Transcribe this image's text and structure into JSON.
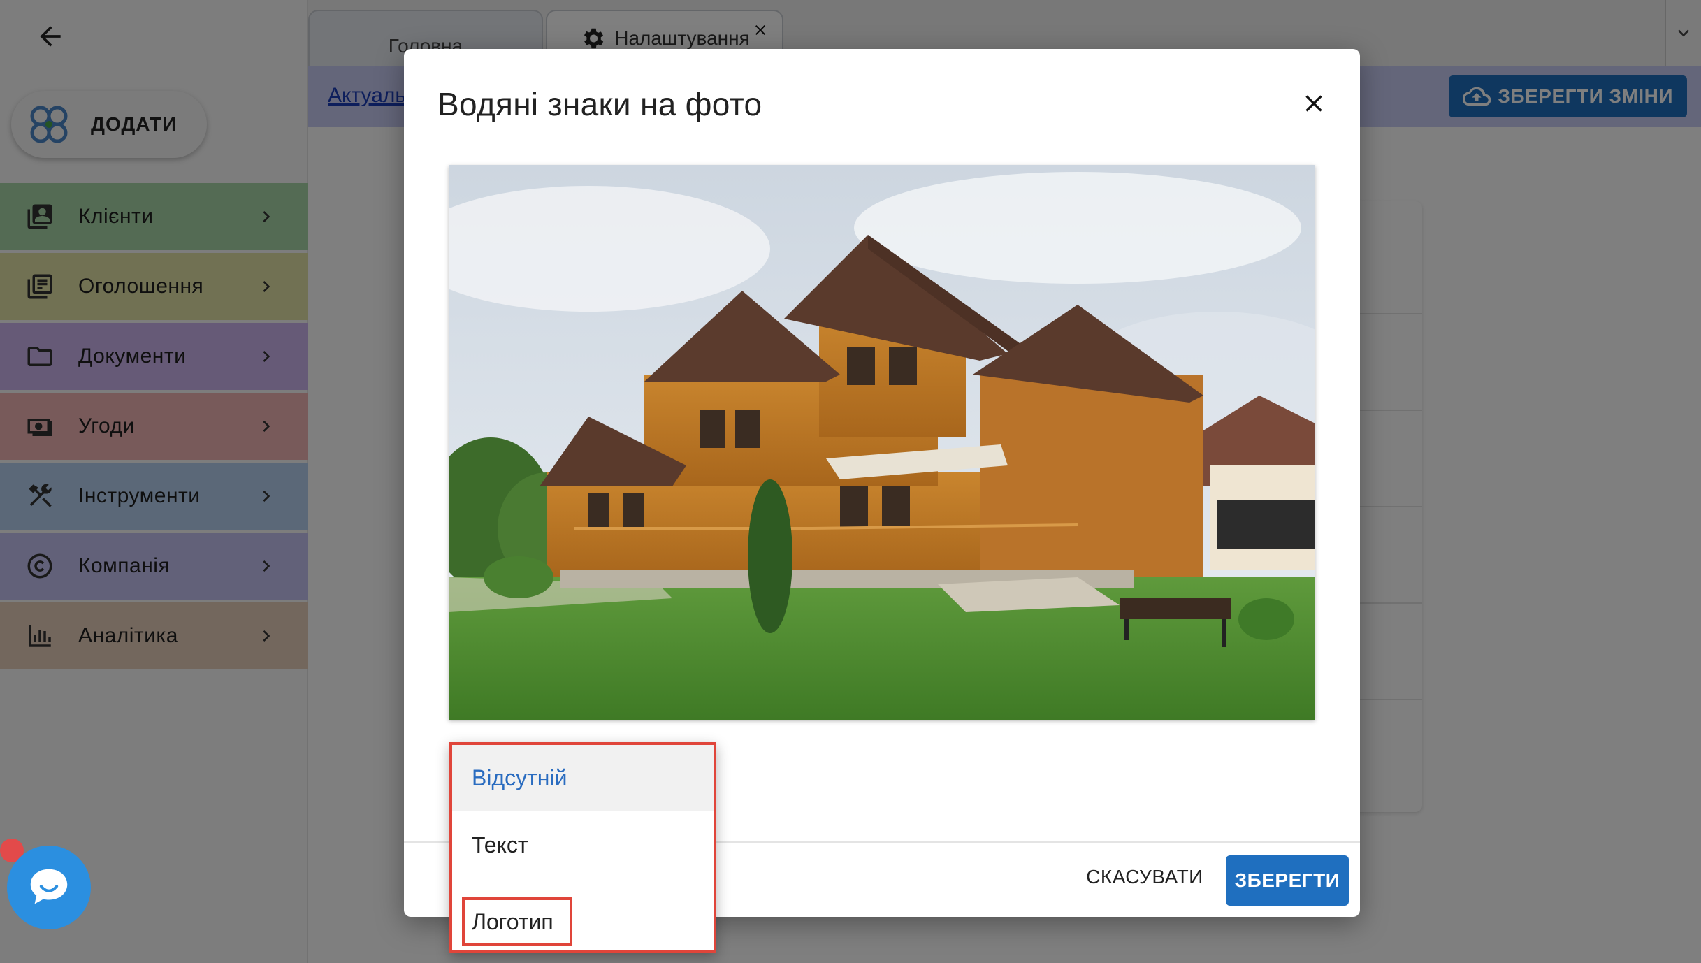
{
  "sidebar": {
    "add_label": "ДОДАТИ",
    "items": [
      {
        "label": "Клієнти",
        "color": "#a9d6a8",
        "icon": "contacts-icon"
      },
      {
        "label": "Оголошення",
        "color": "#e3e3a6",
        "icon": "listings-icon"
      },
      {
        "label": "Документи",
        "color": "#cdb5ef",
        "icon": "folder-icon"
      },
      {
        "label": "Угоди",
        "color": "#f1b4b4",
        "icon": "money-icon"
      },
      {
        "label": "Інструменти",
        "color": "#b7d1f0",
        "icon": "tools-icon"
      },
      {
        "label": "Компанія",
        "color": "#c4c2f2",
        "icon": "copyright-icon"
      },
      {
        "label": "Аналітика",
        "color": "#e7cfbb",
        "icon": "analytics-icon"
      }
    ]
  },
  "tabs": {
    "home": "Головна",
    "settings": "Налаштування"
  },
  "subbar": {
    "link": "Актуальн",
    "save_changes": "ЗБЕРЕГТИ ЗМІНИ"
  },
  "dialog": {
    "title": "Водяні знаки на фото",
    "cancel": "СКАСУВАТИ",
    "save": "ЗБЕРЕГТИ"
  },
  "watermark_dropdown": {
    "options": [
      "Відсутній",
      "Текст",
      "Логотип"
    ],
    "selected": "Відсутній"
  },
  "colors": {
    "accent": "#1f6fbf",
    "highlight": "#e0453a",
    "selected_text": "#2a6cc0"
  }
}
